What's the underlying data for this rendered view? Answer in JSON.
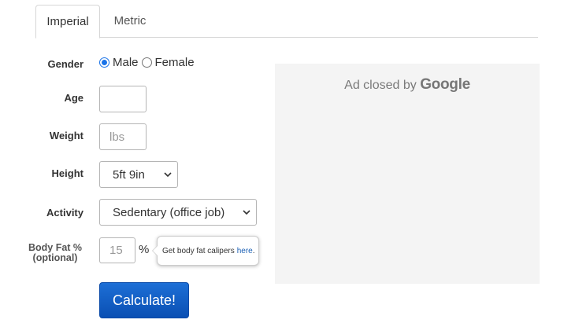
{
  "tabs": [
    {
      "label": "Imperial",
      "active": true
    },
    {
      "label": "Metric",
      "active": false
    }
  ],
  "form": {
    "gender": {
      "label": "Gender",
      "options": [
        "Male",
        "Female"
      ],
      "selected": "Male"
    },
    "age": {
      "label": "Age",
      "value": ""
    },
    "weight": {
      "label": "Weight",
      "placeholder": "lbs",
      "value": ""
    },
    "height": {
      "label": "Height",
      "selected": "5ft 9in"
    },
    "activity": {
      "label": "Activity",
      "selected": "Sedentary (office job)"
    },
    "body_fat": {
      "label_line1": "Body Fat %",
      "label_line2": "(optional)",
      "placeholder": "15",
      "unit": "%"
    },
    "tooltip": {
      "text": "Get body fat calipers",
      "link": "here",
      "end": "."
    },
    "submit_label": "Calculate!"
  },
  "ad": {
    "text": "Ad closed by",
    "brand": "Google"
  },
  "colors": {
    "accent": "#1a73e8",
    "button": "#0a4fb3",
    "link": "#1a5fb4",
    "ad_bg": "#f4f4f4"
  }
}
